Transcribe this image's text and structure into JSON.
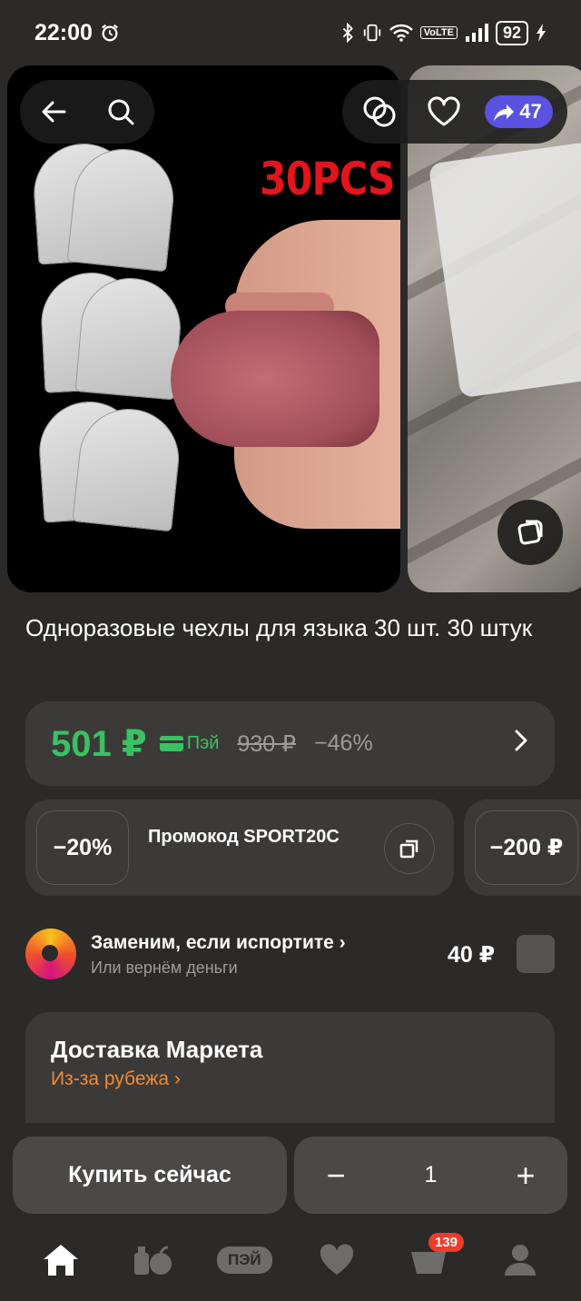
{
  "status": {
    "time": "22:00",
    "network": "VoLTE",
    "battery": "92"
  },
  "gallery": {
    "photo_text": "30PCS",
    "share_count": "47"
  },
  "product": {
    "title": "Одноразовые чехлы для языка 30 шт. 30 штук"
  },
  "price": {
    "current": "501 ₽",
    "pay_label": "Пэй",
    "old": "930 ₽",
    "discount": "−46%"
  },
  "promo": {
    "badge": "−20%",
    "text": "Промокод SPORT20C",
    "next_badge": "−200 ₽"
  },
  "protection": {
    "title": "Заменим, если испортите",
    "subtitle": "Или вернём деньги",
    "price": "40 ₽"
  },
  "delivery": {
    "title": "Доставка Маркета",
    "subtitle": "Из-за рубежа"
  },
  "actions": {
    "buy_label": "Купить сейчас",
    "quantity": "1",
    "minus": "−",
    "plus": "+"
  },
  "nav": {
    "pay_label": "ПЭЙ",
    "cart_count": "139"
  },
  "colors": {
    "accent_green": "#3ac162",
    "orange": "#f28b35",
    "share_badge": "#5a52e0",
    "badge_red": "#ef3b29"
  }
}
